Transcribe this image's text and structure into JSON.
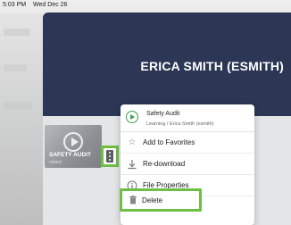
{
  "statusbar": {
    "time": "5:03 PM",
    "date": "Wed Dec 26"
  },
  "profile": {
    "name": "ERICA SMITH (ESMITH)"
  },
  "video_card": {
    "title": "SAFETY AUDIT",
    "type": "VIDEO"
  },
  "menu": {
    "header": {
      "title": "Safety Audit",
      "subtitle": "Learning / Erica Smith (esmith)"
    },
    "items": [
      {
        "label": "Add to Favorites",
        "icon": "star-icon"
      },
      {
        "label": "Re-download",
        "icon": "download-icon"
      },
      {
        "label": "File Properties",
        "icon": "info-icon"
      },
      {
        "label": "Delete",
        "icon": "trash-icon"
      }
    ]
  },
  "colors": {
    "hero": "#2b3754",
    "highlight": "#6fbe44",
    "accent_green": "#3aa14b"
  }
}
